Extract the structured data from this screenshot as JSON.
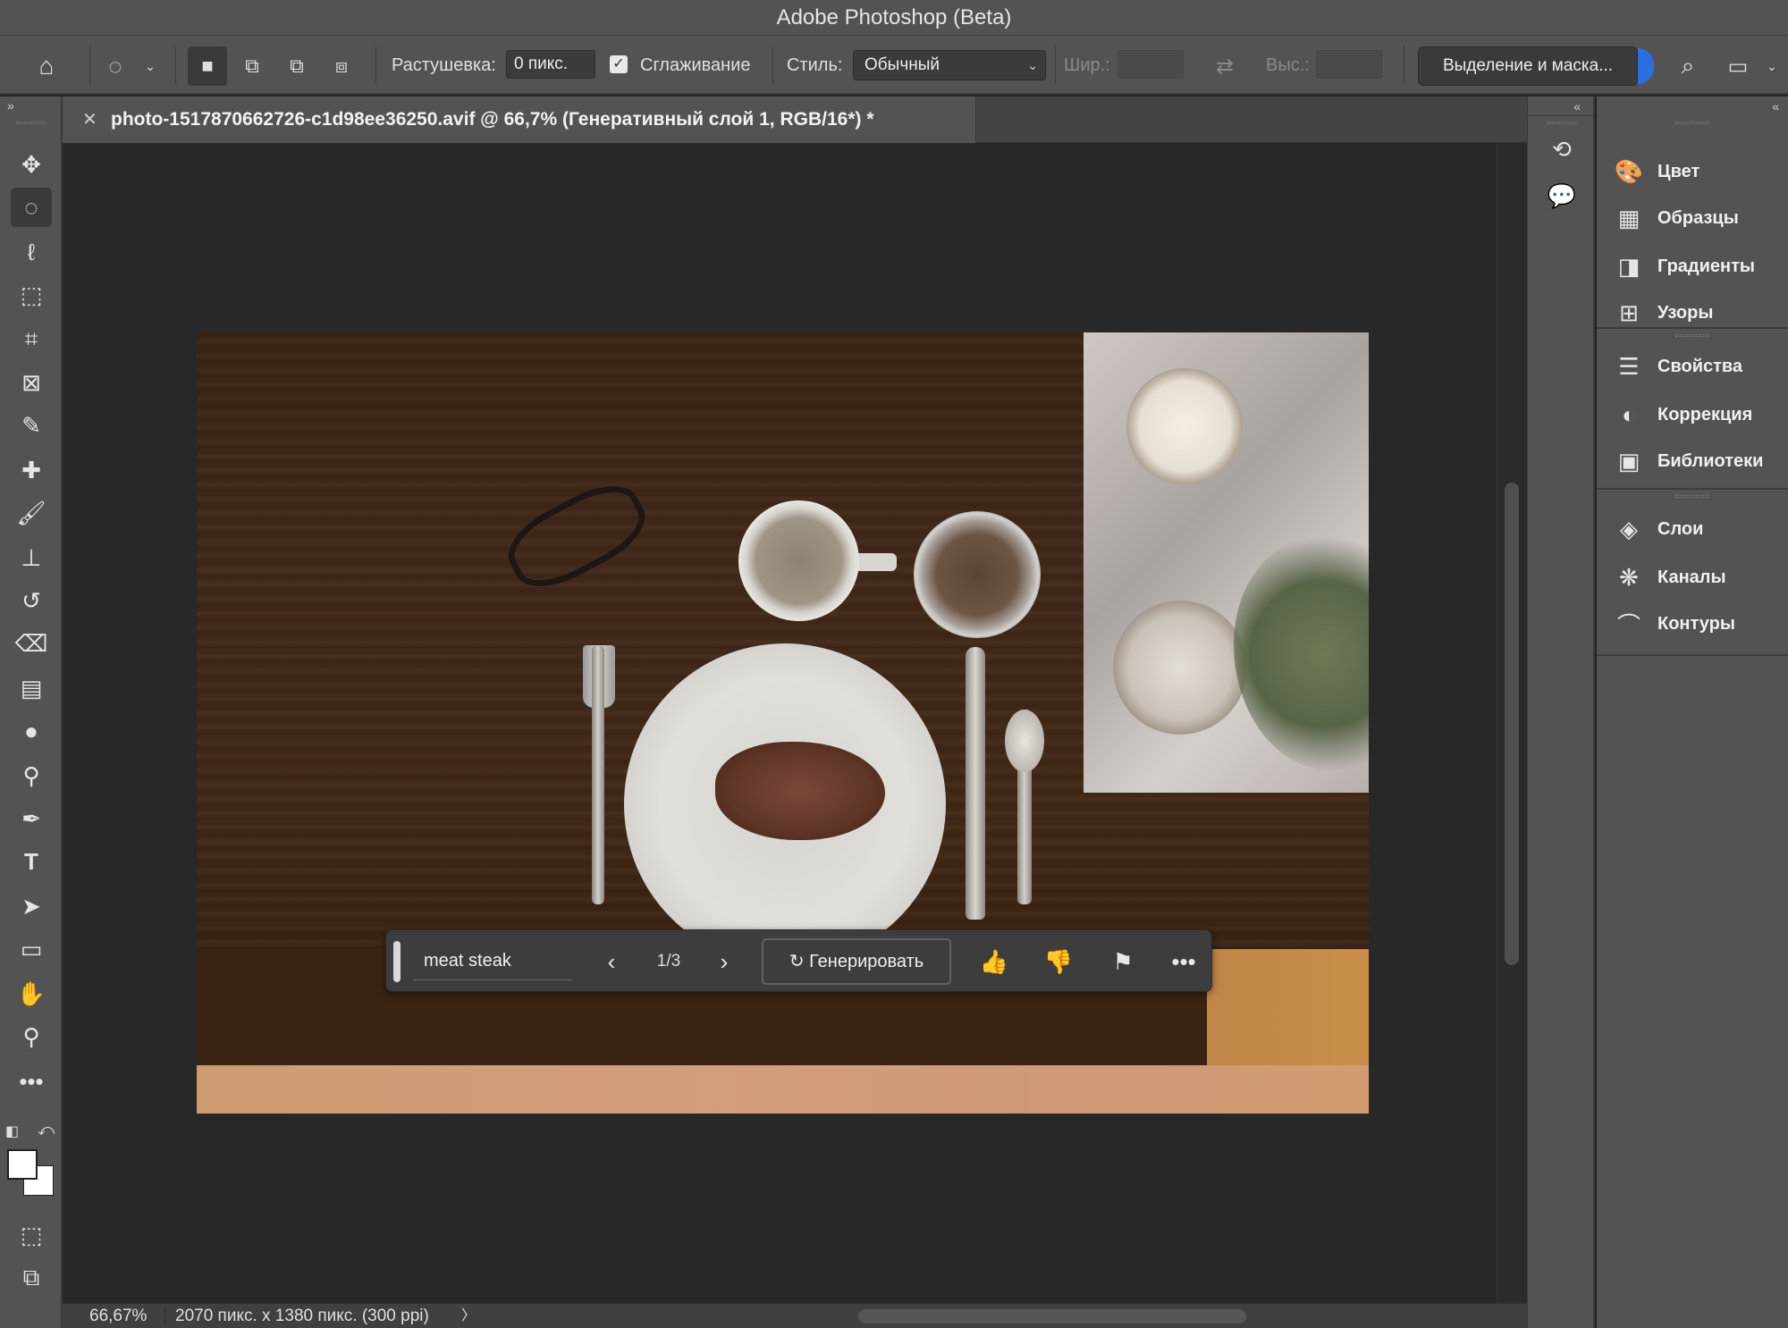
{
  "app": {
    "title": "Adobe Photoshop (Beta)"
  },
  "options_bar": {
    "feather_label": "Растушевка:",
    "feather_value": "0 пикс.",
    "antialias_label": "Сглаживание",
    "antialias_checked": true,
    "style_label": "Стиль:",
    "style_value": "Обычный",
    "width_label": "Шир.:",
    "height_label": "Выс.:",
    "select_mask_label": "Выделение и маска...",
    "accent_color": "#2b6ee0"
  },
  "document": {
    "tab_title": "photo-1517870662726-c1d98ee36250.avif @ 66,7% (Генеративный слой 1, RGB/16*) *",
    "image_subject": "overhead photo of a table setting with steak"
  },
  "generative_bar": {
    "prompt": "meat steak",
    "page_current": 1,
    "page_total": 3,
    "page_label": "1/3",
    "generate_label": "Генерировать"
  },
  "tools": [
    {
      "name": "move-tool",
      "icon": "move-icon"
    },
    {
      "name": "marquee-tool",
      "icon": "ellipse-marquee-icon",
      "active": true
    },
    {
      "name": "lasso-tool",
      "icon": "lasso-icon"
    },
    {
      "name": "object-selection-tool",
      "icon": "object-selection-icon"
    },
    {
      "name": "crop-tool",
      "icon": "crop-icon"
    },
    {
      "name": "frame-tool",
      "icon": "frame-icon"
    },
    {
      "name": "eyedropper-tool",
      "icon": "eyedropper-icon"
    },
    {
      "name": "healing-tool",
      "icon": "bandage-icon"
    },
    {
      "name": "brush-tool",
      "icon": "brush-icon"
    },
    {
      "name": "stamp-tool",
      "icon": "stamp-icon"
    },
    {
      "name": "history-brush-tool",
      "icon": "history-brush-icon"
    },
    {
      "name": "eraser-tool",
      "icon": "eraser-icon"
    },
    {
      "name": "gradient-tool",
      "icon": "gradient-icon"
    },
    {
      "name": "blur-tool",
      "icon": "drop-icon"
    },
    {
      "name": "dodge-tool",
      "icon": "dodge-icon"
    },
    {
      "name": "pen-tool",
      "icon": "pen-icon"
    },
    {
      "name": "type-tool",
      "icon": "type-icon"
    },
    {
      "name": "path-selection-tool",
      "icon": "arrow-icon"
    },
    {
      "name": "rectangle-tool",
      "icon": "rectangle-icon"
    },
    {
      "name": "hand-tool",
      "icon": "hand-icon"
    },
    {
      "name": "zoom-tool",
      "icon": "magnifier-icon"
    },
    {
      "name": "more-tools",
      "icon": "ellipsis-icon"
    }
  ],
  "right_panel": {
    "group1": [
      {
        "label": "Цвет",
        "icon": "palette-icon"
      },
      {
        "label": "Образцы",
        "icon": "swatches-grid-icon"
      },
      {
        "label": "Градиенты",
        "icon": "gradient-swatch-icon"
      },
      {
        "label": "Узоры",
        "icon": "patterns-icon"
      }
    ],
    "group2": [
      {
        "label": "Свойства",
        "icon": "sliders-icon"
      },
      {
        "label": "Коррекция",
        "icon": "adjustment-circle-icon"
      },
      {
        "label": "Библиотеки",
        "icon": "library-icon"
      }
    ],
    "group3": [
      {
        "label": "Слои",
        "icon": "layers-icon"
      },
      {
        "label": "Каналы",
        "icon": "channels-icon"
      },
      {
        "label": "Контуры",
        "icon": "paths-icon"
      }
    ]
  },
  "status_bar": {
    "zoom": "66,67%",
    "doc_info": "2070 пикс. x 1380 пикс. (300 ppi)",
    "arrow": "〉"
  }
}
